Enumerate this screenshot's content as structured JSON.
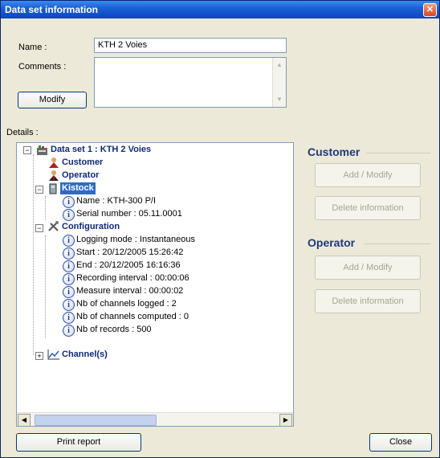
{
  "window": {
    "title": "Data set information"
  },
  "form": {
    "name_label": "Name :",
    "name_value": "KTH 2 Voies",
    "comments_label": "Comments :",
    "comments_value": "",
    "modify_button": "Modify",
    "details_label": "Details :"
  },
  "tree": {
    "root": "Data set 1 : KTH 2 Voies",
    "customer": "Customer",
    "operator": "Operator",
    "kistock": "Kistock",
    "kistock_items": [
      "Name : KTH-300 P/I",
      "Serial number : 05.11.0001"
    ],
    "configuration": "Configuration",
    "configuration_items": [
      "Logging mode : Instantaneous",
      "Start : 20/12/2005 15:26:42",
      "End : 20/12/2005 16:16:36",
      "Recording interval : 00:00:06",
      "Measure interval : 00:00:02",
      "Nb of channels logged : 2",
      "Nb of channels computed : 0",
      "Nb of records : 500"
    ],
    "channels": "Channel(s)"
  },
  "customer_panel": {
    "title": "Customer",
    "add_modify": "Add / Modify",
    "delete": "Delete information"
  },
  "operator_panel": {
    "title": "Operator",
    "add_modify": "Add / Modify",
    "delete": "Delete information"
  },
  "footer": {
    "print_report": "Print report",
    "close": "Close"
  }
}
